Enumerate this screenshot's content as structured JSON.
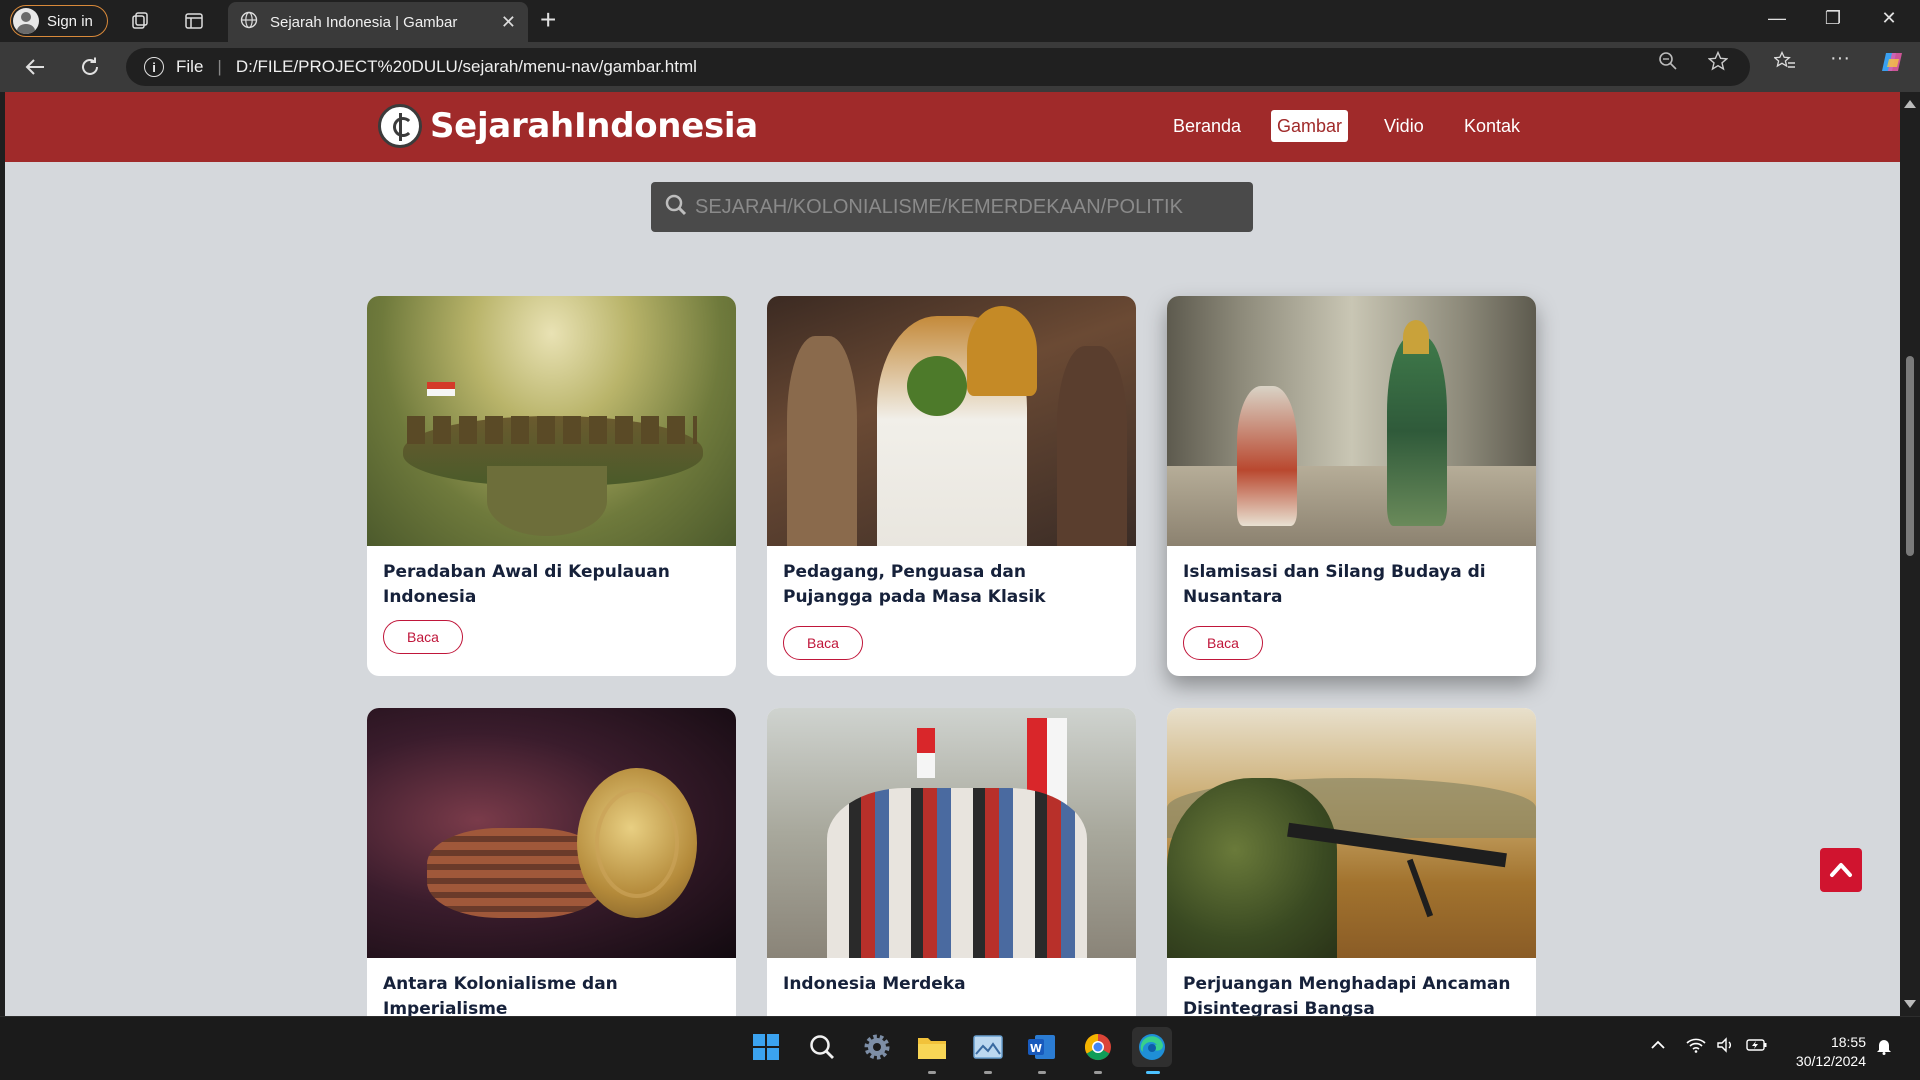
{
  "browser": {
    "sign_in_label": "Sign in",
    "tab_title": "Sejarah Indonesia | Gambar",
    "address_file_label": "File",
    "address_url": "D:/FILE/PROJECT%20DULU/sejarah/menu-nav/gambar.html"
  },
  "site": {
    "brand": "SejarahIndonesia",
    "menu": [
      {
        "label": "Beranda",
        "active": false
      },
      {
        "label": "Gambar",
        "active": true
      },
      {
        "label": "Vidio",
        "active": false
      },
      {
        "label": "Kontak",
        "active": false
      }
    ],
    "search_placeholder": "SEJARAH/KOLONIALISME/KEMERDEKAAN/POLITIK",
    "button_label": "Baca",
    "cards": [
      {
        "title": "Peradaban Awal di Kepulauan Indonesia"
      },
      {
        "title": "Pedagang, Penguasa dan Pujangga pada Masa Klasik"
      },
      {
        "title": "Islamisasi dan Silang Budaya di Nusantara"
      },
      {
        "title": "Antara Kolonialisme dan Imperialisme"
      },
      {
        "title": "Indonesia Merdeka"
      },
      {
        "title": "Perjuangan Menghadapi Ancaman Disintegrasi Bangsa"
      }
    ]
  },
  "taskbar": {
    "time": "18:55",
    "date": "30/12/2024"
  },
  "colors": {
    "nav_red": "#a02a2a",
    "accent_red": "#c0163a",
    "page_bg": "#d5d8dc"
  }
}
